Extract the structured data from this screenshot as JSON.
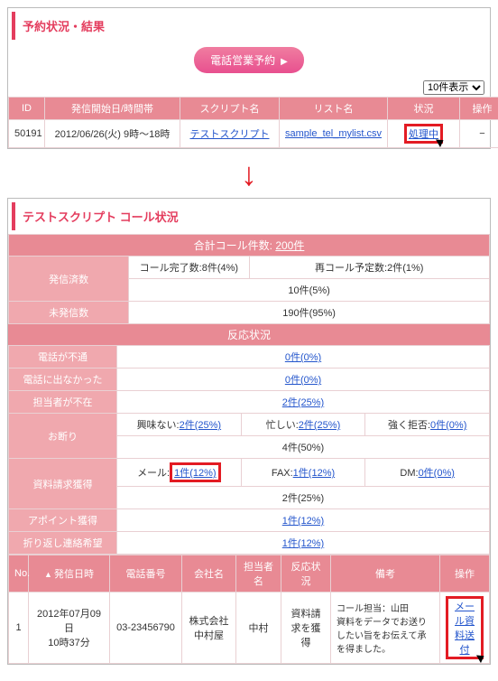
{
  "section1": {
    "title": "予約状況・結果",
    "button": "電話営業予約",
    "display_opt": "10件表示",
    "cols": {
      "id": "ID",
      "start": "発信開始日/時間帯",
      "script": "スクリプト名",
      "list": "リスト名",
      "status": "状況",
      "op": "操作"
    },
    "row": {
      "id": "50191",
      "start": "2012/06/26(火) 9時〜18時",
      "script": "テストスクリプト",
      "list": "sample_tel_mylist.csv",
      "status": "処理中",
      "op": "−"
    }
  },
  "section2": {
    "title": "テストスクリプト コール状況",
    "total_label": "合計コール件数:",
    "total": "200件",
    "rows": {
      "done": "発信済数",
      "done_complete_lbl": "コール完了数:",
      "done_complete": "8件(4%)",
      "recall_lbl": "再コール予定数:",
      "recall": "2件(1%)",
      "done_sub": "10件(5%)",
      "undone": "未発信数",
      "undone_v": "190件(95%)"
    }
  },
  "react": {
    "band": "反応状況",
    "r1": "電話が不通",
    "r1v": "0件(0%)",
    "r2": "電話に出なかった",
    "r2v": "0件(0%)",
    "r3": "担当者が不在",
    "r3v": "2件(25%)",
    "r4": "お断り",
    "r4a_lbl": "興味ない:",
    "r4a": "2件(25%)",
    "r4b_lbl": "忙しい:",
    "r4b": "2件(25%)",
    "r4c_lbl": "強く拒否:",
    "r4c": "0件(0%)",
    "r4sub": "4件(50%)",
    "r5": "資料請求獲得",
    "r5a_lbl": "メール:",
    "r5a": "1件(12%)",
    "r5b_lbl": "FAX:",
    "r5b": "1件(12%)",
    "r5c_lbl": "DM:",
    "r5c": "0件(0%)",
    "r5sub": "2件(25%)",
    "r6": "アポイント獲得",
    "r6v": "1件(12%)",
    "r7": "折り返し連絡希望",
    "r7v": "1件(12%)"
  },
  "detail": {
    "cols": {
      "no": "No.",
      "dt": "発信日時",
      "tel": "電話番号",
      "comp": "会社名",
      "person": "担当者名",
      "react": "反応状況",
      "memo": "備考",
      "op": "操作"
    },
    "row": {
      "no": "1",
      "dt": "2012年07月09日\n10時37分",
      "tel": "03-23456790",
      "comp": "株式会社中村屋",
      "person": "中村",
      "react": "資料請求を獲得",
      "memo": "コール担当：山田\n資料をデータでお送りしたい旨をお伝えて承を得ました。",
      "op": "メール資料送付"
    }
  }
}
